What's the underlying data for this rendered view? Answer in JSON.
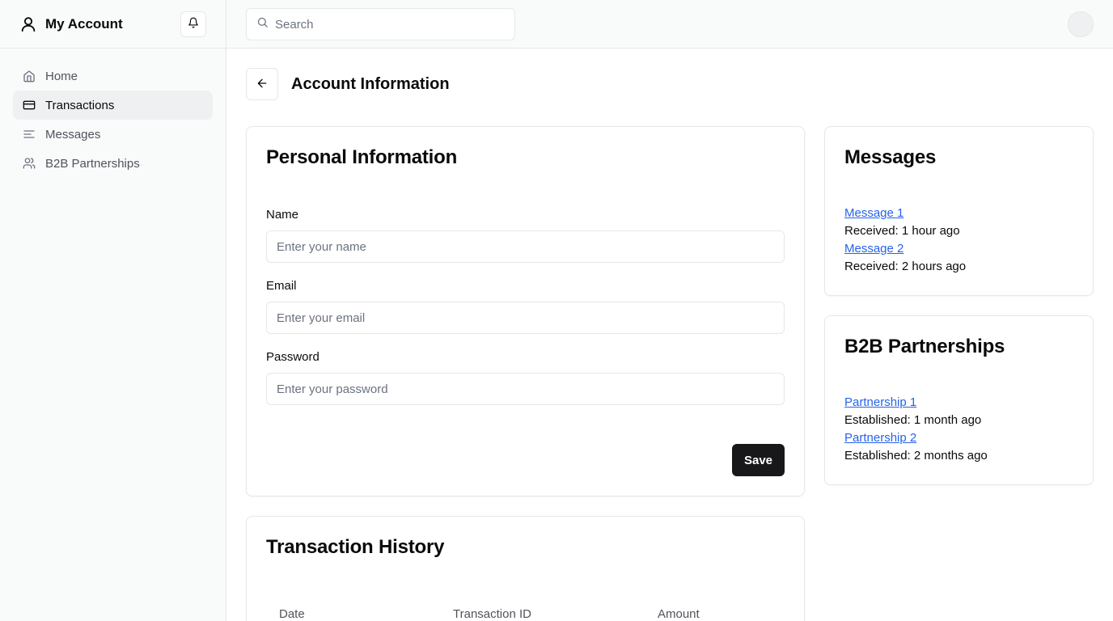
{
  "sidebar": {
    "brand": "My Account",
    "items": [
      {
        "label": "Home",
        "icon": "home-icon",
        "active": false
      },
      {
        "label": "Transactions",
        "icon": "credit-card-icon",
        "active": true
      },
      {
        "label": "Messages",
        "icon": "menu-lines-icon",
        "active": false
      },
      {
        "label": "B2B Partnerships",
        "icon": "users-icon",
        "active": false
      }
    ]
  },
  "topbar": {
    "search_placeholder": "Search"
  },
  "page": {
    "title": "Account Information"
  },
  "personal": {
    "title": "Personal Information",
    "name_label": "Name",
    "name_placeholder": "Enter your name",
    "email_label": "Email",
    "email_placeholder": "Enter your email",
    "password_label": "Password",
    "password_placeholder": "Enter your password",
    "save_label": "Save"
  },
  "messages": {
    "title": "Messages",
    "items": [
      {
        "link": "Message 1",
        "meta": "Received: 1 hour ago"
      },
      {
        "link": "Message 2",
        "meta": "Received: 2 hours ago"
      }
    ]
  },
  "b2b": {
    "title": "B2B Partnerships",
    "items": [
      {
        "link": "Partnership 1",
        "meta": "Established: 1 month ago"
      },
      {
        "link": "Partnership 2",
        "meta": "Established: 2 months ago"
      }
    ]
  },
  "history": {
    "title": "Transaction History",
    "columns": [
      "Date",
      "Transaction ID",
      "Amount"
    ]
  },
  "colors": {
    "accent_dark": "#18181b",
    "link": "#2563eb",
    "sidebar_bg": "#f9fafa",
    "active_bg": "#eef0f2"
  }
}
